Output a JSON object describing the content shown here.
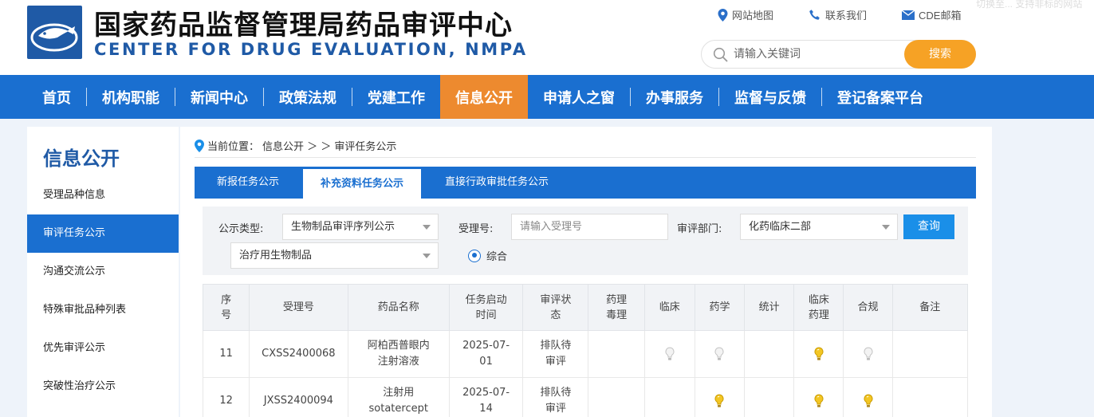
{
  "header": {
    "title_cn": "国家药品监督管理局药品审评中心",
    "title_en": "CENTER FOR DRUG EVALUATION, NMPA",
    "logo_icon": "fish-logo-icon",
    "top_links": [
      {
        "label": "网站地图",
        "icon": "location-pin-icon"
      },
      {
        "label": "联系我们",
        "icon": "phone-icon"
      },
      {
        "label": "CDE邮箱",
        "icon": "mail-icon"
      }
    ],
    "ghost_text": "切换至...  支持非标的网站",
    "search": {
      "placeholder": "请输入关键词",
      "button": "搜索"
    }
  },
  "nav": {
    "items": [
      "首页",
      "机构职能",
      "新闻中心",
      "政策法规",
      "党建工作",
      "信息公开",
      "申请人之窗",
      "办事服务",
      "监督与反馈",
      "登记备案平台"
    ],
    "active_index": 5
  },
  "sidebar": {
    "title": "信息公开",
    "items": [
      "受理品种信息",
      "审评任务公示",
      "沟通交流公示",
      "特殊审批品种列表",
      "优先审评公示",
      "突破性治疗公示"
    ],
    "active_index": 1
  },
  "breadcrumb": {
    "prefix": "当前位置：",
    "path": "信息公开 ＞ ＞ 审评任务公示"
  },
  "tabs": {
    "items": [
      "新报任务公示",
      "补充资料任务公示",
      "直接行政审批任务公示"
    ],
    "active_index": 1
  },
  "filters": {
    "type_label": "公示类型:",
    "type_value": "生物制品审评序列公示",
    "accept_label": "受理号:",
    "accept_placeholder": "请输入受理号",
    "dept_label": "审评部门:",
    "dept_value": "化药临床二部",
    "query_button": "查询",
    "subtype_value": "治疗用生物制品",
    "radio_label": "综合"
  },
  "table": {
    "headers": [
      "序号",
      "受理号",
      "药品名称",
      "任务启动时间",
      "审评状态",
      "药理毒理",
      "临床",
      "药学",
      "统计",
      "临床药理",
      "合规",
      "备注"
    ],
    "header_lines": [
      [
        "序",
        "号"
      ],
      [
        "受理号"
      ],
      [
        "药品名称"
      ],
      [
        "任务启动",
        "时间"
      ],
      [
        "审评状",
        "态"
      ],
      [
        "药理",
        "毒理"
      ],
      [
        "临床"
      ],
      [
        "药学"
      ],
      [
        "统计"
      ],
      [
        "临床",
        "药理"
      ],
      [
        "合规"
      ],
      [
        "备注"
      ]
    ],
    "rows": [
      {
        "no": "11",
        "accept_no": "CXSS2400068",
        "name_lines": [
          "阿柏西普眼内",
          "注射溶液"
        ],
        "date_lines": [
          "2025-07-",
          "01"
        ],
        "status_lines": [
          "排队待",
          "审评"
        ],
        "bulbs": {
          "pharmtox": "none",
          "clinical": "off",
          "pharm": "off",
          "stats": "none",
          "clinpharm": "on",
          "compliance": "off"
        }
      },
      {
        "no": "12",
        "accept_no": "JXSS2400094",
        "name_lines": [
          "注射用",
          "sotatercept"
        ],
        "date_lines": [
          "2025-07-",
          "14"
        ],
        "status_lines": [
          "排队待",
          "审评"
        ],
        "bulbs": {
          "pharmtox": "none",
          "clinical": "none",
          "pharm": "on",
          "stats": "none",
          "clinpharm": "on",
          "compliance": "on"
        }
      }
    ]
  },
  "colors": {
    "brand_blue": "#1a6fd0",
    "nav_active": "#ed8a2f",
    "search_btn": "#f6a225",
    "bulb_on": "#f3c623",
    "bulb_off": "#d9d9d9"
  }
}
